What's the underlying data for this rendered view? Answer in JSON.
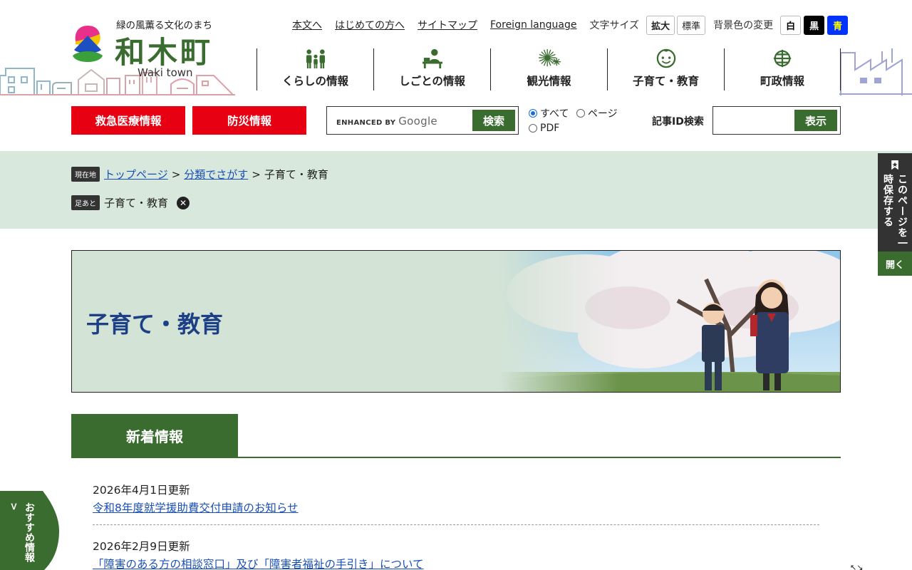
{
  "logo": {
    "tagline": "緑の風薫る文化のまち",
    "title": "和木町",
    "en": "Waki town"
  },
  "util": {
    "links": [
      "本文へ",
      "はじめての方へ",
      "サイトマップ",
      "Foreign language"
    ],
    "font_size_label": "文字サイズ",
    "font_size_buttons": [
      "拡大",
      "標準"
    ],
    "bg_label": "背景色の変更",
    "bg_buttons": [
      "白",
      "黒",
      "青"
    ]
  },
  "gnav": [
    {
      "label": "くらしの情報",
      "icon": "family-icon"
    },
    {
      "label": "しごとの情報",
      "icon": "worker-desk-icon"
    },
    {
      "label": "観光情報",
      "icon": "fireworks-icon"
    },
    {
      "label": "子育て・教育",
      "icon": "child-face-icon"
    },
    {
      "label": "町政情報",
      "icon": "town-emblem-icon"
    }
  ],
  "quick": {
    "emergency": "救急医療情報",
    "disaster": "防災情報"
  },
  "search": {
    "enhanced_by": "ENHANCED BY",
    "google": "Google",
    "button": "検索",
    "options": [
      "すべて",
      "ページ",
      "PDF"
    ],
    "selected": "すべて"
  },
  "article_id": {
    "label": "記事ID検索",
    "button": "表示"
  },
  "breadcrumb": {
    "current_tag": "現在地",
    "items": [
      "トップページ",
      "分類でさがす",
      "子育て・教育"
    ],
    "history_tag": "足あと",
    "history_item": "子育て・教育"
  },
  "side_tab": {
    "text": "このページを一時保存する",
    "open": "開く"
  },
  "hero": {
    "title": "子育て・教育"
  },
  "news": {
    "heading": "新着情報",
    "items": [
      {
        "date": "2026年4月1日更新",
        "title": "令和8年度就学援助費交付申請のお知らせ"
      },
      {
        "date": "2026年2月9日更新",
        "title": "「障害のある方の相談窓口」及び「障害者福祉の手引き」について"
      }
    ]
  },
  "recommend": {
    "text": "おすすめ​情報 >"
  },
  "colors": {
    "brand_green": "#3a6b2f",
    "emergency_red": "#e60012",
    "band_green": "#d8e8dc",
    "link_blue": "#1a4fb5"
  }
}
